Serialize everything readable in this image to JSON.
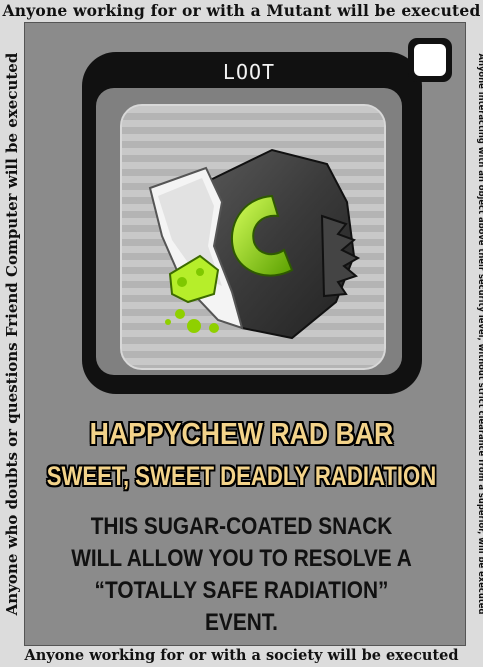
{
  "border": {
    "top": "Anyone working for or with a Mutant will be executed",
    "bottom": "Anyone working for or with a society will be executed",
    "left": "Anyone who doubts or questions Friend Computer will be executed",
    "right": "Anyone interacting with an object above their security level, without strict clearance from a superior, will be executed"
  },
  "card": {
    "type_label": "LOOT",
    "title": "HAPPYCHEW RAD BAR",
    "subtitle": "SWEET, SWEET DEADLY RADIATION",
    "description": "THIS SUGAR-COATED SNACK WILL ALLOW YOU TO RESOLVE A “TOTALLY SAFE RADIATION” EVENT.",
    "art_icon": "candy-bar-icon"
  },
  "colors": {
    "card_bg": "#8b8b8b",
    "frame": "#111111",
    "title": "#f3d38a",
    "slime": "#8fd000"
  }
}
